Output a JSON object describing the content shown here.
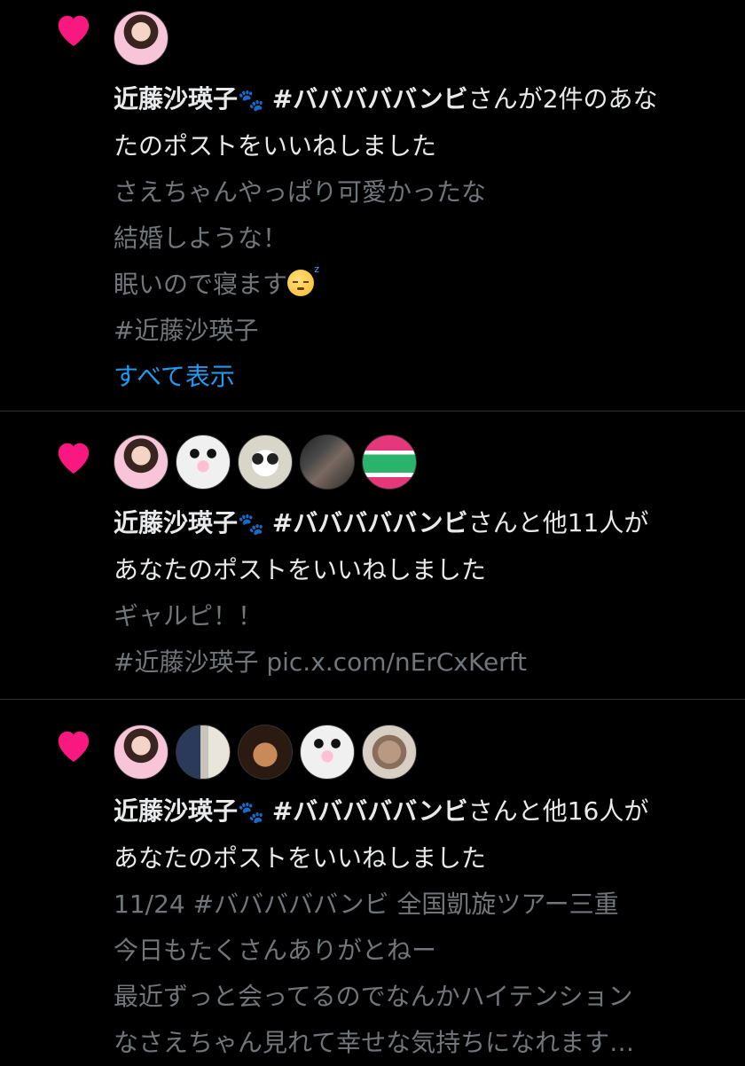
{
  "notifications": [
    {
      "avatars": [
        "idol-photo-avatar"
      ],
      "actor_name": "近藤沙瑛子",
      "actor_tag": "#バババババンビ",
      "action_text": "さんが2件のあな",
      "action_text_2": "たのポストをいいねしました",
      "lines": [
        "さえちゃんやっぱり可愛かったな",
        "結婚しような！",
        "眠いので寝ます"
      ],
      "hashtag_line": " #近藤沙瑛子",
      "show_all_label": "すべて表示"
    },
    {
      "avatars": [
        "idol-photo-avatar",
        "panda-avatar",
        "panda-cartoon-avatar",
        "group-photo-avatar",
        "colorful-badge-avatar"
      ],
      "actor_name": "近藤沙瑛子",
      "actor_tag": "#バババババンビ",
      "action_text": "さんと他11人が",
      "action_text_2": "あなたのポストをいいねしました",
      "lines": [
        "ギャルピ！！"
      ],
      "hashtag_line": " #近藤沙瑛子 pic.x.com/nErCxKerft"
    },
    {
      "avatars": [
        "idol-photo-avatar",
        "people-photo-avatar",
        "anime-face-avatar",
        "panda-avatar",
        "cup-photo-avatar"
      ],
      "actor_name": "近藤沙瑛子",
      "actor_tag": "#バババババンビ",
      "action_text": "さんと他16人が",
      "action_text_2": "あなたのポストをいいねしました",
      "lines": [
        "11/24 #バババババンビ 全国凱旋ツアー三重",
        "今日もたくさんありがとねー",
        "最近ずっと会ってるのでなんかハイテンション",
        "なさえちゃん見れて幸せな気持ちになれます…"
      ]
    }
  ],
  "colors": {
    "heart": "#f91880",
    "link": "#1d9bf0",
    "muted": "#71767b"
  }
}
